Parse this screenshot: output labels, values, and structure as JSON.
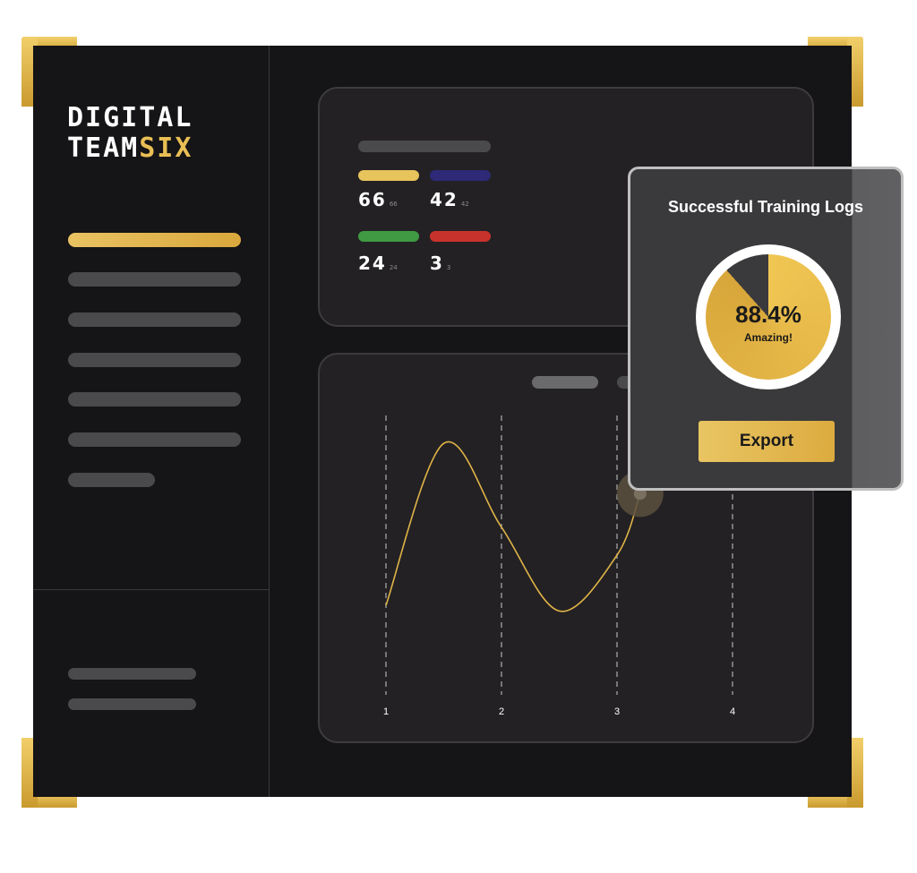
{
  "brand": {
    "line1": "DIGITAL",
    "line2_main": "TEAM",
    "line2_accent": "SIX",
    "accent_color": "#e9bf55"
  },
  "stats": [
    {
      "value": "66",
      "sub": "66",
      "color": "#e8c45c"
    },
    {
      "value": "42",
      "sub": "42",
      "color": "#2e2a78"
    },
    {
      "value": "24",
      "sub": "24",
      "color": "#3f9a43"
    },
    {
      "value": "3",
      "sub": "3",
      "color": "#c8322c"
    }
  ],
  "chart_data": {
    "type": "line",
    "x": [
      1,
      1.5,
      2,
      2.5,
      3,
      3.2
    ],
    "y": [
      0.32,
      0.9,
      0.6,
      0.3,
      0.5,
      0.72
    ],
    "x_ticks": [
      "1",
      "2",
      "3",
      "4"
    ],
    "xlim": [
      1,
      4
    ],
    "ylim": [
      0,
      1
    ],
    "line_color": "#e0b447",
    "grid": "vertical-dashed"
  },
  "popup": {
    "title": "Successful Training Logs",
    "percent_value": 88.4,
    "percent_label": "88.4%",
    "caption": "Amazing!",
    "export_label": "Export"
  }
}
